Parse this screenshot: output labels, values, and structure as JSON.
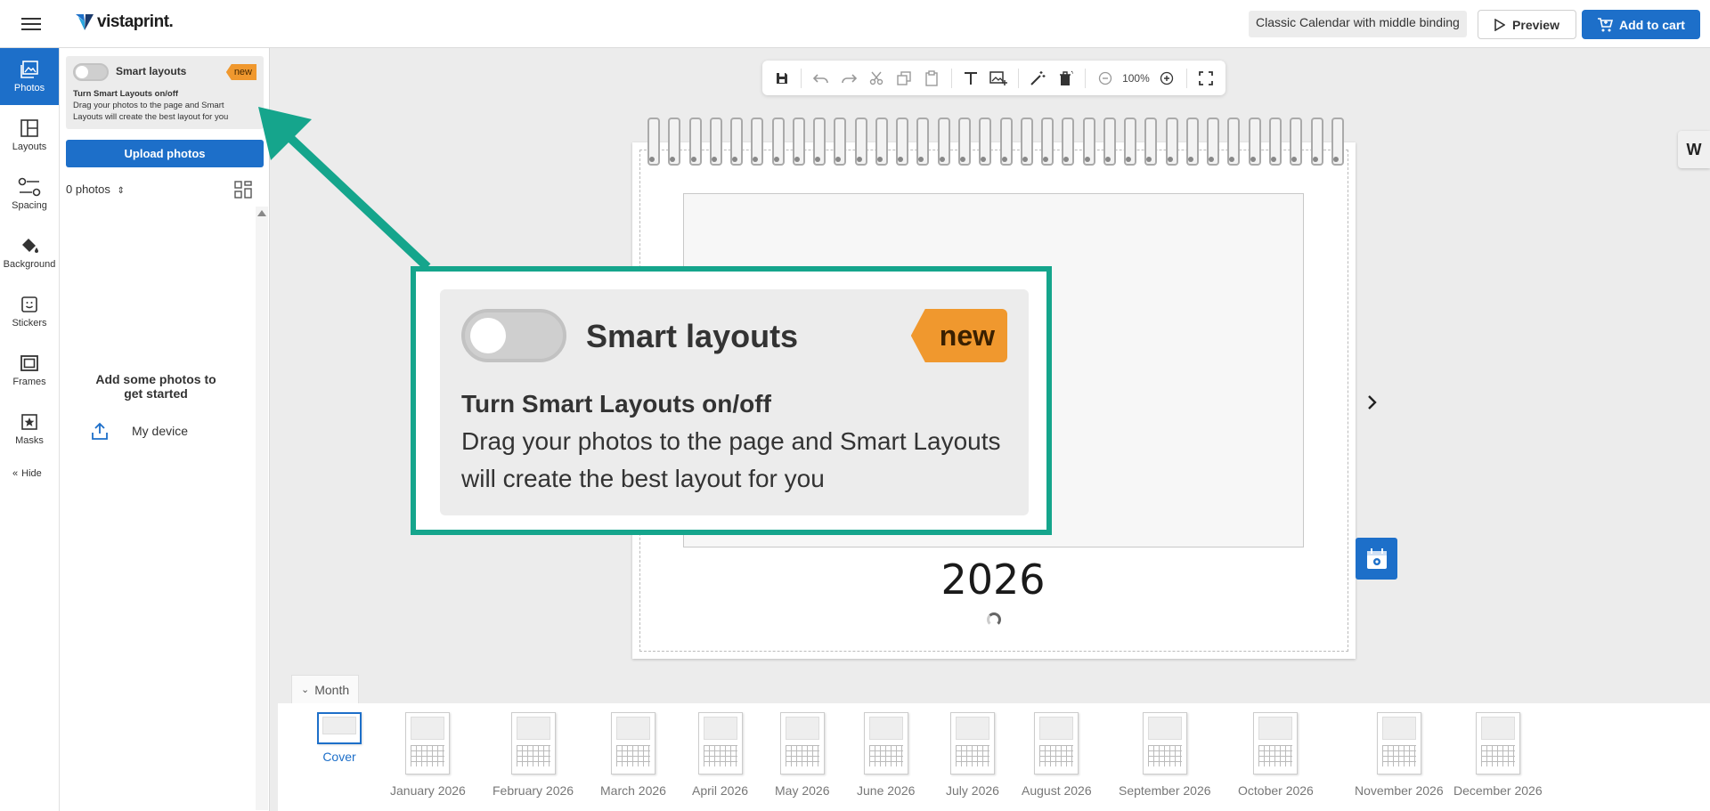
{
  "header": {
    "logo_text": "vistaprint.",
    "product_name": "Classic Calendar with middle binding",
    "preview_label": "Preview",
    "add_to_cart_label": "Add to cart"
  },
  "rail": {
    "items": [
      {
        "label": "Photos",
        "icon": "photos-icon",
        "active": true
      },
      {
        "label": "Layouts",
        "icon": "layouts-icon"
      },
      {
        "label": "Spacing",
        "icon": "spacing-icon"
      },
      {
        "label": "Background",
        "icon": "paint-bucket-icon"
      },
      {
        "label": "Stickers",
        "icon": "sticker-icon"
      },
      {
        "label": "Frames",
        "icon": "frame-icon"
      },
      {
        "label": "Masks",
        "icon": "mask-icon"
      }
    ],
    "hide_label": "Hide"
  },
  "panel": {
    "smart_layouts": {
      "title": "Smart layouts",
      "badge": "new",
      "subtitle_bold": "Turn Smart Layouts on/off",
      "subtitle": "Drag your photos to the page and Smart Layouts will create the best layout for you"
    },
    "upload_label": "Upload photos",
    "photo_count": "0 photos",
    "empty_title": "Add some photos to get started",
    "my_device": "My device"
  },
  "toolbar": {
    "zoom": "100%"
  },
  "canvas": {
    "year": "2026"
  },
  "callout": {
    "title": "Smart layouts",
    "badge": "new",
    "subtitle_bold": "Turn Smart Layouts on/off",
    "subtitle": "Drag your photos to the page and Smart Layouts will create the best layout for you",
    "accent_color": "#15a58c"
  },
  "month_strip": {
    "tab_label": "Month",
    "pages": [
      {
        "label": "Cover"
      },
      {
        "label": "January 2026"
      },
      {
        "label": "February 2026"
      },
      {
        "label": "March 2026"
      },
      {
        "label": "April 2026"
      },
      {
        "label": "May 2026"
      },
      {
        "label": "June 2026"
      },
      {
        "label": "July 2026"
      },
      {
        "label": "August 2026"
      },
      {
        "label": "September 2026"
      },
      {
        "label": "October 2026"
      },
      {
        "label": "November 2026"
      },
      {
        "label": "December 2026"
      }
    ]
  },
  "colors": {
    "brand_blue": "#1d6fc9",
    "badge_orange": "#f0982e",
    "highlight_green": "#15a58c"
  }
}
